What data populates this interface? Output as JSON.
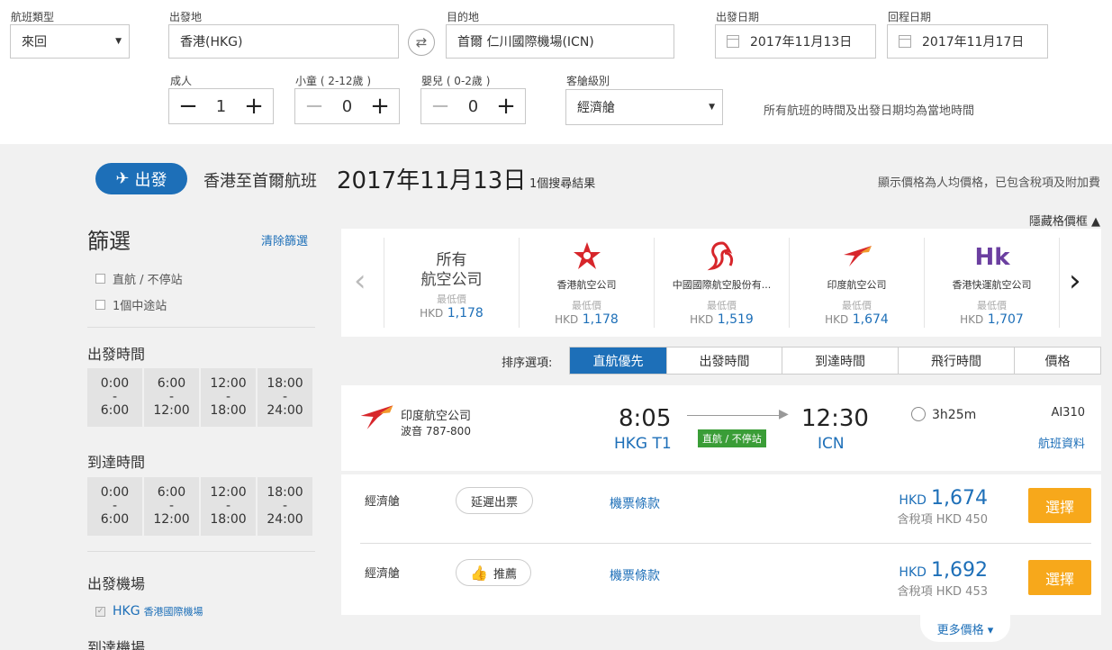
{
  "search": {
    "trip_type_label": "航班類型",
    "trip_type_value": "來回",
    "origin_label": "出發地",
    "origin_value": "香港(HKG)",
    "destination_label": "目的地",
    "destination_value": "首爾 仁川國際機場(ICN)",
    "depart_date_label": "出發日期",
    "depart_date_value": "2017年11月13日",
    "return_date_label": "回程日期",
    "return_date_value": "2017年11月17日",
    "adult_label": "成人",
    "adult_value": "1",
    "child_label": "小童 ( 2-12歲 )",
    "child_value": "0",
    "infant_label": "嬰兒 ( 0-2歲 )",
    "infant_value": "0",
    "cabin_label": "客艙級別",
    "cabin_value": "經濟艙",
    "timezone_note": "所有航班的時間及出發日期均為當地時間"
  },
  "header": {
    "depart_pill": "出發",
    "route_title": "香港至首爾航班",
    "date": "2017年11月13日",
    "result_count": "1個搜尋結果",
    "price_note": "顯示價格為人均價格，已包含稅項及附加費",
    "hide_price_frame": "隱藏格價框 ▲"
  },
  "filters": {
    "title": "篩選",
    "clear": "清除篩選",
    "stops": [
      "直航 / 不停站",
      "1個中途站"
    ],
    "depart_time_title": "出發時間",
    "arrive_time_title": "到達時間",
    "time_slots": [
      {
        "from": "0:00",
        "to": "6:00"
      },
      {
        "from": "6:00",
        "to": "12:00"
      },
      {
        "from": "12:00",
        "to": "18:00"
      },
      {
        "from": "18:00",
        "to": "24:00"
      }
    ],
    "depart_airport_title": "出發機場",
    "depart_airport_code": "HKG",
    "depart_airport_name": "香港國際機場",
    "arrive_airport_title": "到達機場"
  },
  "airlines": {
    "lowest_label": "最低價",
    "currency": "HKD",
    "all_line1": "所有",
    "all_line2": "航空公司",
    "all_price": "1,178",
    "items": [
      {
        "name": "香港航空公司",
        "price": "1,178",
        "icon": "hk-airlines-logo"
      },
      {
        "name": "中國國際航空股份有...",
        "price": "1,519",
        "icon": "air-china-logo"
      },
      {
        "name": "印度航空公司",
        "price": "1,674",
        "icon": "air-india-logo"
      },
      {
        "name": "香港快運航空公司",
        "price": "1,707",
        "icon": "hk-express-logo"
      }
    ]
  },
  "sort": {
    "label": "排序選項:",
    "options": [
      "直航優先",
      "出發時間",
      "到達時間",
      "飛行時間",
      "價格"
    ]
  },
  "flight": {
    "airline": "印度航空公司",
    "aircraft": "波音 787-800",
    "dep_time": "8:05",
    "dep_airport": "HKG T1",
    "arr_time": "12:30",
    "arr_airport": "ICN",
    "nonstop": "直航 / 不停站",
    "duration": "3h25m",
    "flight_no": "AI310",
    "details_link": "航班資料"
  },
  "fares": [
    {
      "cabin": "經濟艙",
      "tag": "延遲出票",
      "terms": "機票條款",
      "currency": "HKD",
      "price": "1,674",
      "tax": "含稅項 HKD 450",
      "select": "選擇"
    },
    {
      "cabin": "經濟艙",
      "tag": "推薦",
      "terms": "機票條款",
      "currency": "HKD",
      "price": "1,692",
      "tax": "含稅項 HKD 453",
      "select": "選擇"
    }
  ],
  "more_prices": "更多價格 ▾",
  "colors": {
    "brand_blue": "#1d6fb8",
    "select_orange": "#f7a81b",
    "nonstop_green": "#3a9d37",
    "air_india_red": "#d7262b"
  }
}
